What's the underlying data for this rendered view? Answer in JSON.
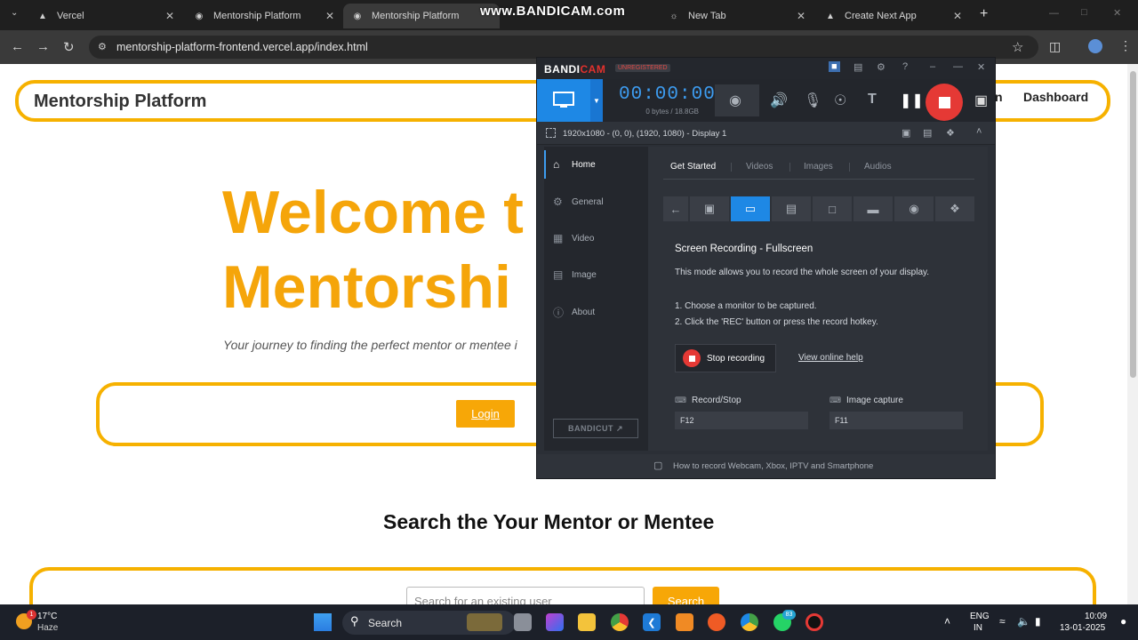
{
  "browser": {
    "tabs": [
      {
        "title": "Vercel",
        "icon": "vercel-icon"
      },
      {
        "title": "Mentorship Platform",
        "icon": "globe-icon"
      },
      {
        "title": "Mentorship Platform",
        "icon": "globe-icon",
        "active": true
      },
      {
        "title": "",
        "icon": "globe-icon"
      },
      {
        "title": "New Tab",
        "icon": "chrome-icon"
      },
      {
        "title": "Create Next App",
        "icon": "vercel-icon"
      }
    ],
    "url": "mentorship-platform-frontend.vercel.app/index.html"
  },
  "watermark": "www.BANDICAM.com",
  "site": {
    "brand": "Mentorship Platform",
    "nav_partial": "n",
    "nav_dashboard": "Dashboard",
    "hero_line1": "Welcome t",
    "hero_line2": "Mentorshi",
    "tagline": "Your journey to finding the perfect mentor or mentee i",
    "login_label": "Login",
    "search_title": "Search the Your Mentor or Mentee",
    "search_placeholder": "Search for an existing user",
    "search_button": "Search",
    "accent": "#f6b100"
  },
  "bandicam": {
    "logo_a": "BANDI",
    "logo_b": "CAM",
    "unregistered": "UNREGISTERED",
    "timer": "00:00:00",
    "bytes": "0 bytes / 18.8GB",
    "resolution": "1920x1080 - (0, 0), (1920, 1080) - Display 1",
    "sidebar": [
      {
        "label": "Home",
        "icon": "home-icon",
        "active": true
      },
      {
        "label": "General",
        "icon": "gear-icon"
      },
      {
        "label": "Video",
        "icon": "video-icon"
      },
      {
        "label": "Image",
        "icon": "image-icon"
      },
      {
        "label": "About",
        "icon": "info-icon"
      }
    ],
    "bandicut": "BANDICUT",
    "tabs": [
      {
        "label": "Get Started",
        "active": true
      },
      {
        "label": "Videos"
      },
      {
        "label": "Images"
      },
      {
        "label": "Audios"
      }
    ],
    "mode_title": "Screen Recording - Fullscreen",
    "mode_desc": "This mode allows you to record the whole screen of your display.",
    "step1": "1. Choose a monitor to be captured.",
    "step2": "2. Click the 'REC' button or press the record hotkey.",
    "stop_label": "Stop recording",
    "help_link": "View online help",
    "hotkey1_label": "Record/Stop",
    "hotkey1_value": "F12",
    "hotkey2_label": "Image capture",
    "hotkey2_value": "F11",
    "footer": "How to record Webcam, Xbox, IPTV and Smartphone",
    "accent": "#1e88e5",
    "rec_color": "#e53935"
  },
  "taskbar": {
    "temp": "17°C",
    "weather": "Haze",
    "weather_badge": "1",
    "search": "Search",
    "notif_count": "83",
    "lang1": "ENG",
    "lang2": "IN",
    "time": "10:09",
    "date": "13-01-2025"
  }
}
